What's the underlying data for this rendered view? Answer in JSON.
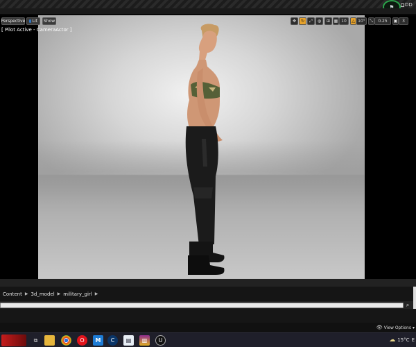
{
  "window": {
    "top_right_letters": "DD"
  },
  "viewport": {
    "perspective_label": "Perspective",
    "lit_label": "Lit",
    "show_label": "Show",
    "pilot_label": "[ Pilot Active - CameraActor ]",
    "grid_value": "10",
    "angle_value": "10°",
    "scale_value": "0.25",
    "camera_speed": "3"
  },
  "content_browser": {
    "breadcrumb": [
      "Content",
      "3d_model",
      "military_girl"
    ],
    "search_placeholder": "",
    "view_options_label": "View Options"
  },
  "taskbar": {
    "m_label": "M",
    "c_label": "C",
    "temperature": "15°C",
    "tray_letter": "E"
  },
  "colors": {
    "accent_orange": "#e6a22b",
    "status_green": "#2aa34a",
    "lit_blue": "#2f74c0"
  }
}
